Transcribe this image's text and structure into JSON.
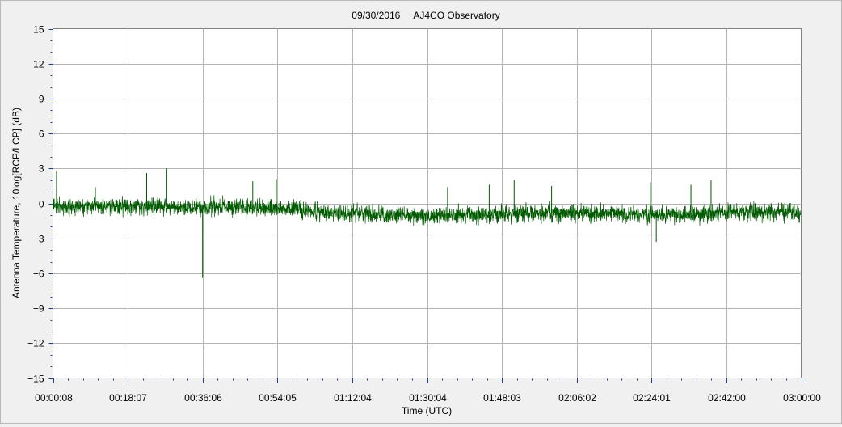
{
  "chart_data": {
    "type": "line",
    "title": "09/30/2016     AJ4CO Observatory",
    "xlabel": "Time (UTC)",
    "ylabel": "Antenna Temperature, 10log[RCP/LCP] (dB)",
    "ylim": [
      -15,
      15
    ],
    "y_ticks": [
      15,
      12,
      9,
      6,
      3,
      0,
      -3,
      -6,
      -9,
      -12,
      -15
    ],
    "y_tick_labels": [
      "15",
      "12",
      "9",
      "6",
      "3",
      "0",
      "−3",
      "−6",
      "−9",
      "−12",
      "−15"
    ],
    "x_range": [
      "00:00:08",
      "03:00:00"
    ],
    "x_tick_labels": [
      "00:00:08",
      "00:18:07",
      "00:36:06",
      "00:54:05",
      "01:12:04",
      "01:30:04",
      "01:48:03",
      "02:06:02",
      "02:24:01",
      "02:42:00",
      "03:00:00"
    ],
    "grid": true,
    "series": [
      {
        "color": "#005a00",
        "baseline": [
          {
            "x": "00:00:08",
            "y": -0.3
          },
          {
            "x": "00:18:07",
            "y": -0.3
          },
          {
            "x": "00:36:06",
            "y": -0.3
          },
          {
            "x": "00:54:05",
            "y": -0.4
          },
          {
            "x": "01:12:04",
            "y": -0.9
          },
          {
            "x": "01:30:04",
            "y": -1.1
          },
          {
            "x": "01:48:03",
            "y": -0.9
          },
          {
            "x": "02:06:02",
            "y": -0.8
          },
          {
            "x": "02:24:01",
            "y": -1.0
          },
          {
            "x": "02:42:00",
            "y": -0.8
          },
          {
            "x": "03:00:00",
            "y": -0.7
          }
        ],
        "noise_band_db": 1.1,
        "spikes": [
          {
            "x": "00:01:00",
            "y": 2.8
          },
          {
            "x": "00:10:20",
            "y": 1.4
          },
          {
            "x": "00:22:40",
            "y": 2.6
          },
          {
            "x": "00:27:30",
            "y": 3.0
          },
          {
            "x": "00:36:06",
            "y": -6.4
          },
          {
            "x": "00:48:10",
            "y": 1.9
          },
          {
            "x": "00:53:50",
            "y": 2.1
          },
          {
            "x": "01:35:00",
            "y": 1.4
          },
          {
            "x": "01:45:00",
            "y": 1.6
          },
          {
            "x": "01:51:00",
            "y": 2.0
          },
          {
            "x": "02:00:00",
            "y": 1.5
          },
          {
            "x": "02:23:45",
            "y": 1.8
          },
          {
            "x": "02:25:10",
            "y": -3.3
          },
          {
            "x": "02:33:30",
            "y": 1.6
          },
          {
            "x": "02:38:20",
            "y": 2.0
          }
        ]
      }
    ]
  }
}
